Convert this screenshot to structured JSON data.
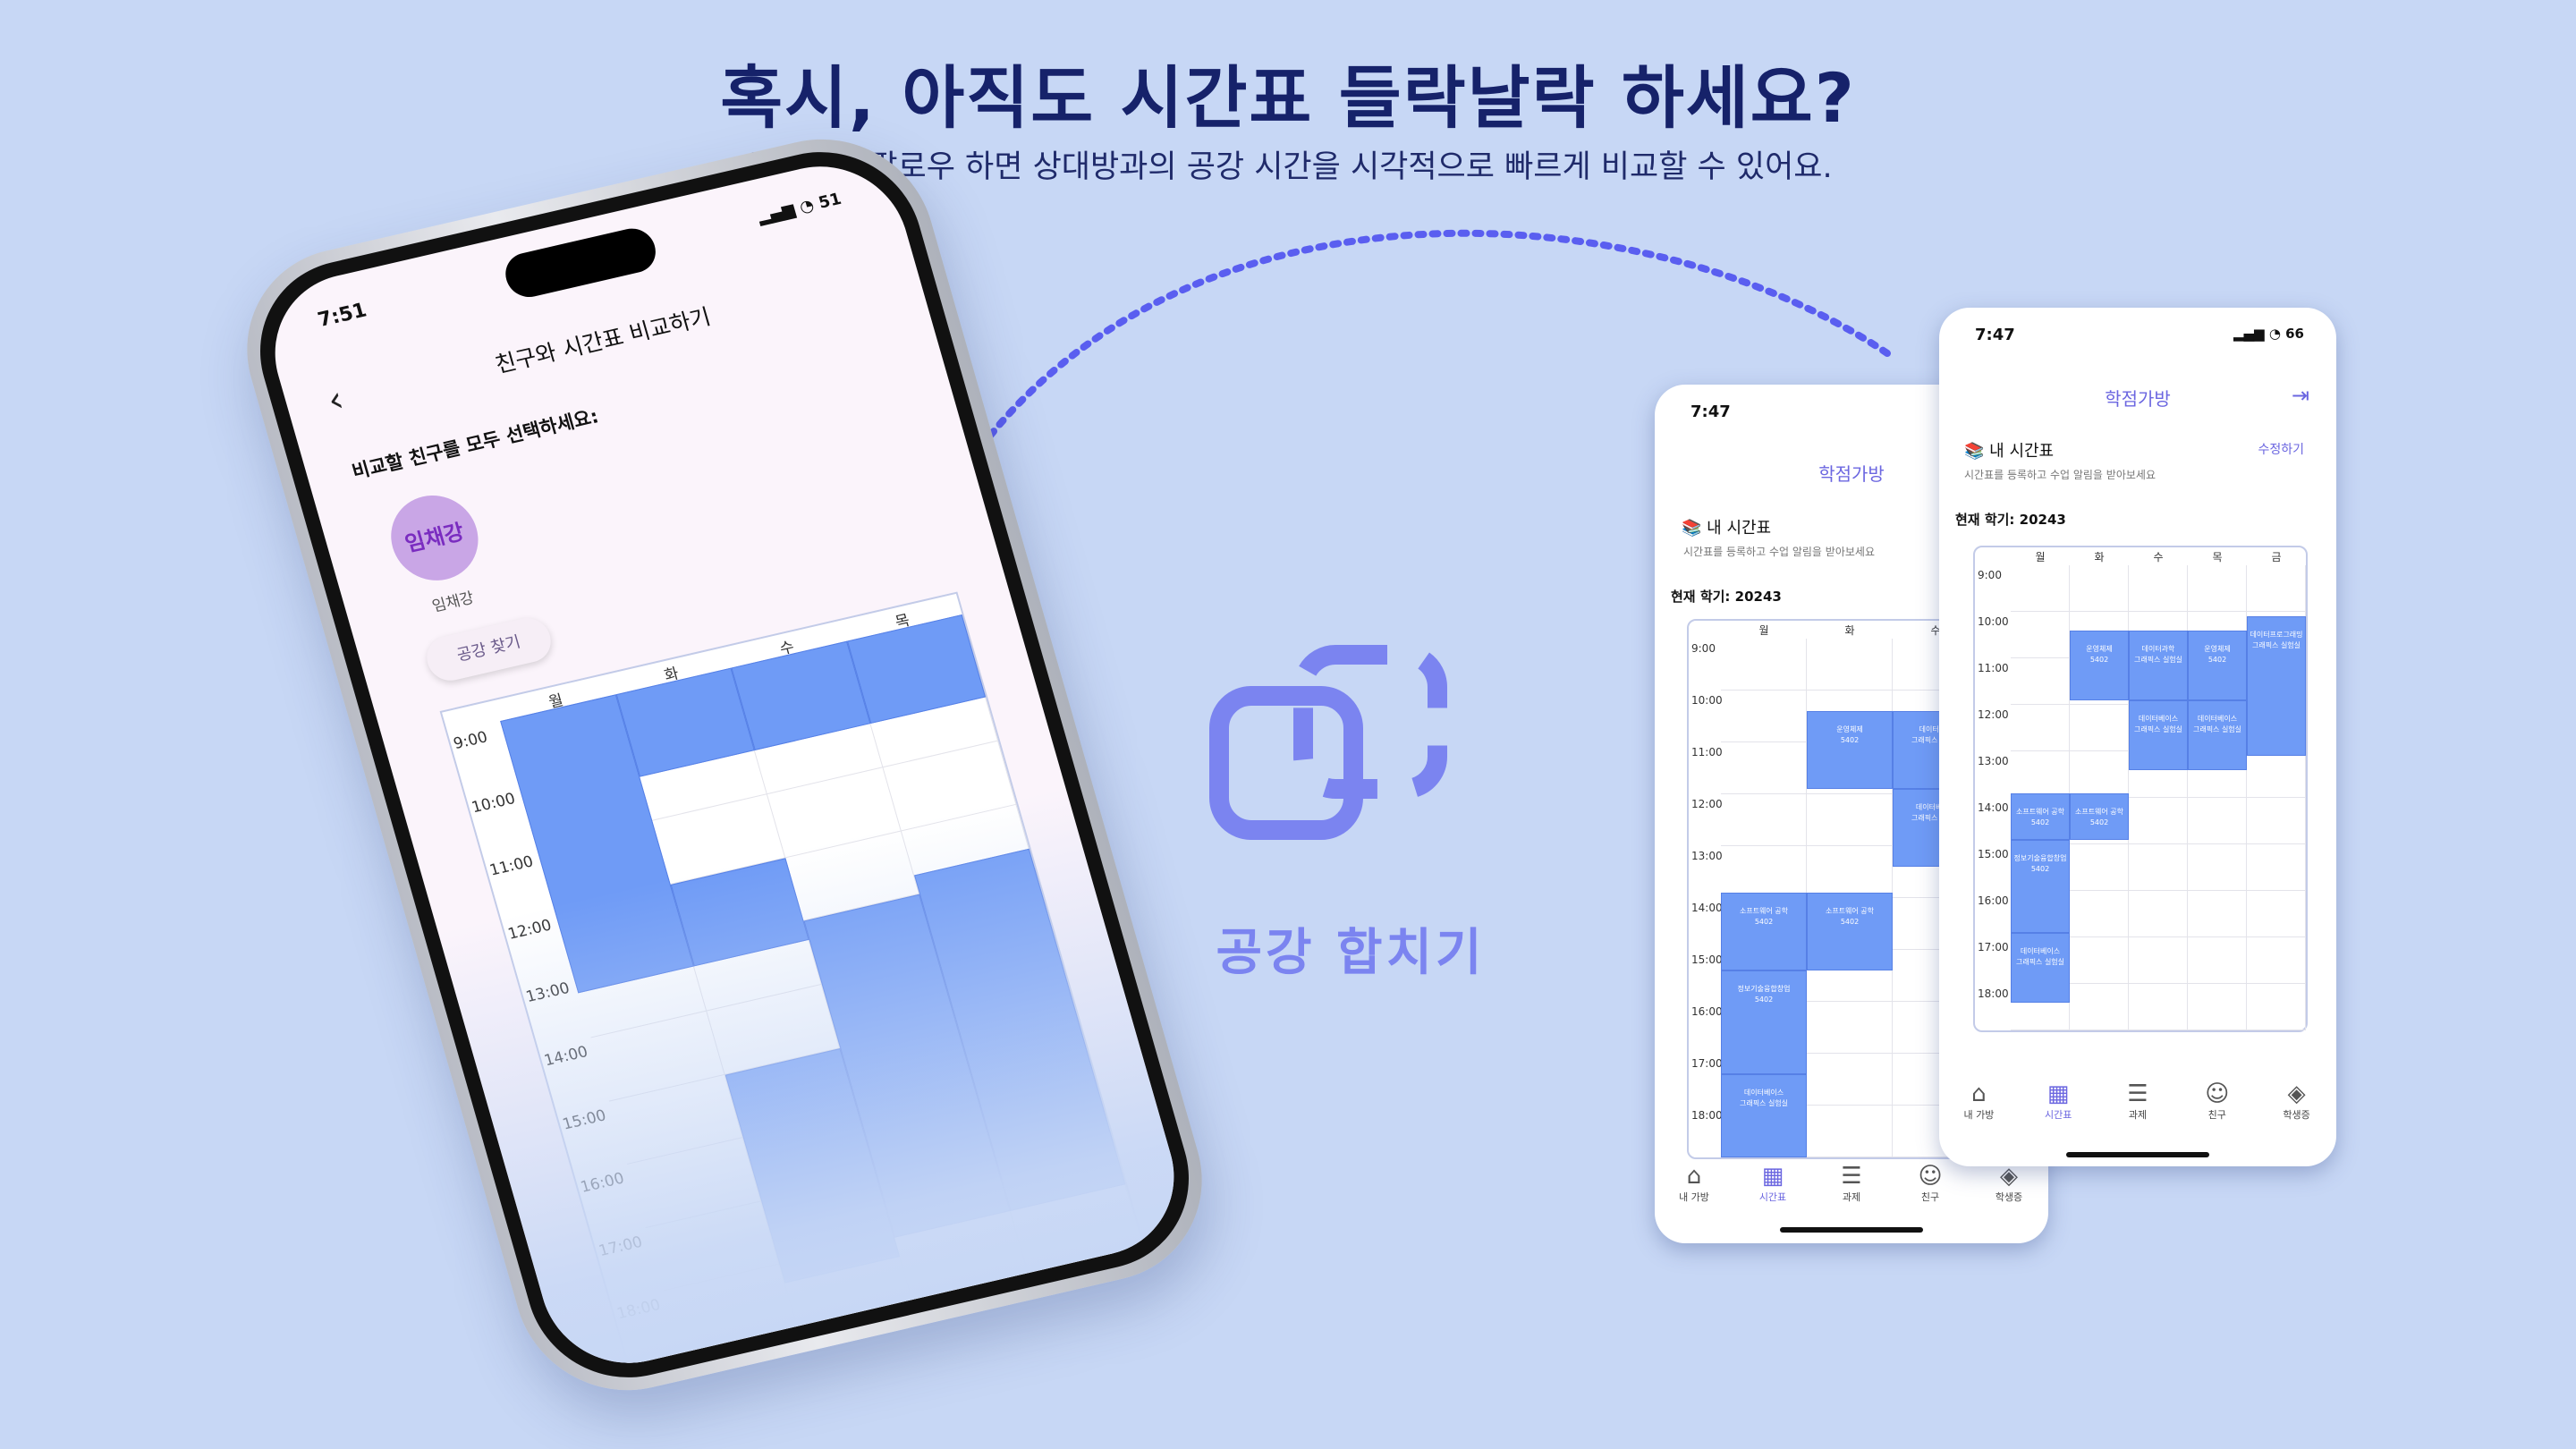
{
  "hero": {
    "headline": "혹시, 아직도 시간표 들락날락 하세요?",
    "subline": "상대방을 팔로우 하면 상대방과의 공강 시간을 시각적으로 빠르게 비교할 수 있어요."
  },
  "center": {
    "label": "공강 합치기",
    "icon": "merge-frames-icon"
  },
  "compare_phone": {
    "status_time": "7:51",
    "battery": "51",
    "title": "친구와 시간표 비교하기",
    "prompt": "비교할 친구를 모두 선택하세요:",
    "friend_avatar": "임채강",
    "friend_name": "임채강",
    "find_button": "공강 찾기",
    "days": [
      "월",
      "화",
      "수",
      "목"
    ],
    "times": [
      "9:00",
      "10:00",
      "11:00",
      "12:00",
      "13:00",
      "14:00",
      "15:00",
      "16:00",
      "17:00",
      "18:00"
    ]
  },
  "phone_back": {
    "status_time": "7:47",
    "app_title": "학점가방",
    "section": "내 시간표",
    "section_sub": "시간표를 등록하고 수업 알림을 받아보세요",
    "semester": "현재 학기: 20243",
    "days": [
      "월",
      "화",
      "수",
      "목"
    ],
    "times": [
      "9:00",
      "10:00",
      "11:00",
      "12:00",
      "13:00",
      "14:00",
      "15:00",
      "16:00",
      "17:00",
      "18:00"
    ],
    "blocks": [
      "운영체제\n5402",
      "데이터과학\n그래픽스 실험실",
      "데이터과학\n그래픽스 실험실",
      "데이터베이스\n그래픽스 실험실",
      "데이터베이스\n그래픽스 실험실",
      "소프트웨어 공학\n5402",
      "소프트웨어 공학\n5402",
      "정보기술융합창업\n5402",
      "데이터베이스\n그래픽스 실험실"
    ],
    "nav": [
      "내 가방",
      "시간표",
      "과제",
      "친구",
      "학생증"
    ]
  },
  "phone_front": {
    "status_time": "7:47",
    "battery": "66",
    "app_title": "학점가방",
    "section": "내 시간표",
    "edit": "수정하기",
    "section_sub": "시간표를 등록하고 수업 알림을 받아보세요",
    "semester": "현재 학기: 20243",
    "days": [
      "월",
      "화",
      "수",
      "목",
      "금"
    ],
    "times": [
      "9:00",
      "10:00",
      "11:00",
      "12:00",
      "13:00",
      "14:00",
      "15:00",
      "16:00",
      "17:00",
      "18:00"
    ],
    "blocks": [
      "운영체제\n5402",
      "데이터과학\n그래픽스 실험실",
      "운영체제\n5402",
      "데이터프로그래밍\n그래픽스 실험실",
      "데이터베이스\n그래픽스 실험실",
      "데이터베이스\n그래픽스 실험실",
      "소프트웨어 공학\n5402",
      "소프트웨어 공학\n5402",
      "정보기술융합창업\n5402",
      "데이터베이스\n그래픽스 실험실"
    ],
    "nav": [
      "내 가방",
      "시간표",
      "과제",
      "친구",
      "학생증"
    ]
  },
  "colors": {
    "background": "#c7d7f5",
    "accent": "#6b66e0",
    "block": "#6f9bf6",
    "headline": "#16226a"
  }
}
